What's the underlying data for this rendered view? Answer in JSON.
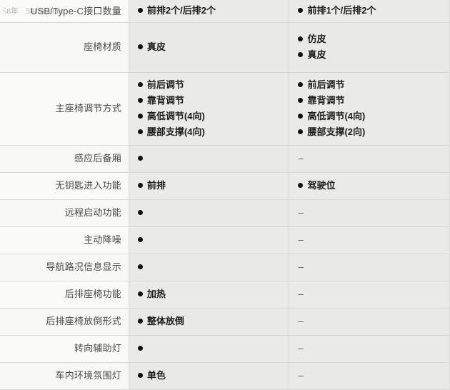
{
  "watermark": {
    "left_text": "58年",
    "right_text": "58che.com"
  },
  "table": {
    "columns": [
      {
        "key": "label",
        "header": ""
      },
      {
        "key": "config_a",
        "header": ""
      },
      {
        "key": "config_b",
        "header": ""
      }
    ],
    "dash": "–",
    "rows": [
      {
        "label": "USB/Type-C接口数量",
        "col1": [
          "前排2个/后排2个"
        ],
        "col2": [
          "前排1个/后排2个"
        ]
      },
      {
        "label": "座椅材质",
        "col1": [
          "真皮"
        ],
        "col2": [
          "仿皮",
          "真皮"
        ]
      },
      {
        "label": "主座椅调节方式",
        "col1": [
          "前后调节",
          "靠背调节",
          "高低调节(4向)",
          "腰部支撑(4向)"
        ],
        "col2": [
          "前后调节",
          "靠背调节",
          "高低调节(4向)",
          "腰部支撑(2向)"
        ]
      },
      {
        "label": "感应后备厢",
        "col1": [
          ""
        ],
        "col2": null
      },
      {
        "label": "无钥匙进入功能",
        "col1": [
          "前排"
        ],
        "col2": [
          "驾驶位"
        ]
      },
      {
        "label": "远程启动功能",
        "col1": [
          ""
        ],
        "col2": null
      },
      {
        "label": "主动降噪",
        "col1": [
          ""
        ],
        "col2": null
      },
      {
        "label": "导航路况信息显示",
        "col1": [
          ""
        ],
        "col2": null
      },
      {
        "label": "后排座椅功能",
        "col1": [
          "加热"
        ],
        "col2": null
      },
      {
        "label": "后排座椅放倒形式",
        "col1": [
          "整体放倒"
        ],
        "col2": null
      },
      {
        "label": "转向辅助灯",
        "col1": [
          ""
        ],
        "col2": null
      },
      {
        "label": "车内环境氛围灯",
        "col1": [
          "单色"
        ],
        "col2": null
      }
    ]
  },
  "colors": {
    "label_bg": "#fafaf8",
    "data_bg": "#eaeae8",
    "border": "#d8d8d4",
    "bullet": "#111111",
    "label_text": "#4a4a4a",
    "value_text": "#1d1d1d"
  }
}
